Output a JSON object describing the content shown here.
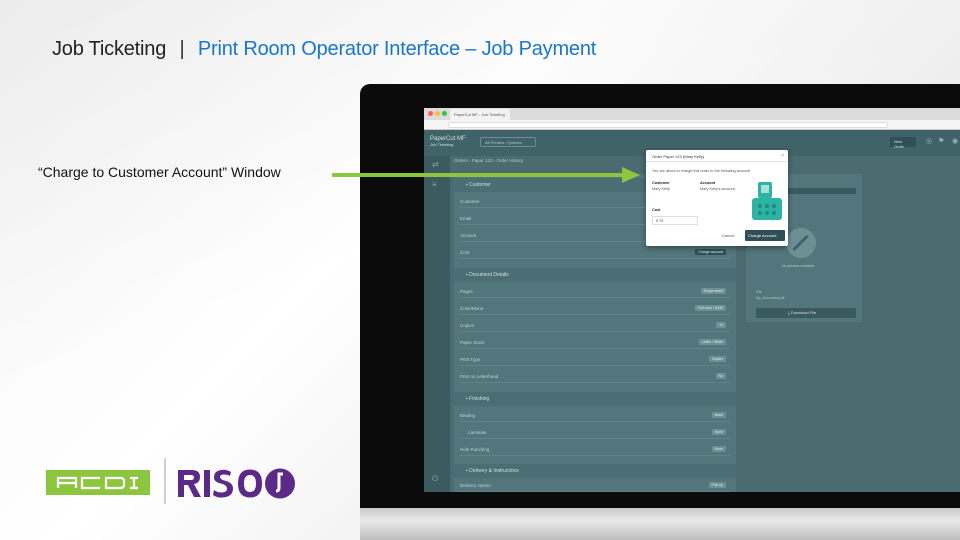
{
  "slide": {
    "title": "Job Ticketing",
    "separator": "|",
    "subtitle": "Print Room Operator Interface – Job Payment",
    "callout": "“Charge to Customer Account” Window"
  },
  "colors": {
    "accent_green": "#8cc63f",
    "title_blue": "#1a76c9",
    "app_teal": "#52767b",
    "modal_button": "#2f4f54"
  },
  "browser": {
    "tab_label": "PaperCut MF - Job Ticketing"
  },
  "app": {
    "logo_line1": "PaperCut MF",
    "logo_line2": "Job Ticketing",
    "header_dropdown": "All Printers / Queues",
    "new_job_button": "New Order",
    "breadcrumb": "Orders › Paper 123 › Order History",
    "sections": [
      {
        "title": "Customer",
        "icon": "person-icon"
      },
      {
        "title": "Document Details",
        "icon": "document-icon"
      },
      {
        "title": "Finishing",
        "icon": "finishing-icon"
      },
      {
        "title": "Delivery & Instructions",
        "icon": "truck-icon"
      }
    ],
    "customer_rows": [
      {
        "label": "Customer",
        "value": ""
      },
      {
        "label": "Email",
        "value": ""
      },
      {
        "label": "Account",
        "value": ""
      },
      {
        "label": "Cost",
        "value": "Charge account"
      }
    ],
    "document_rows": [
      {
        "label": "Pages",
        "value": "Single sided"
      },
      {
        "label": "Color/Mono",
        "value": "Full color / B&W"
      },
      {
        "label": "Copies",
        "value": "10"
      },
      {
        "label": "Paper Stock",
        "value": "Letter / White"
      },
      {
        "label": "Print Type",
        "value": "Duplex"
      },
      {
        "label": "Print on Letterhead",
        "value": "No"
      }
    ],
    "finishing_rows": [
      {
        "label": "Binding",
        "value": "None"
      },
      {
        "label": "Laminate",
        "value": "None"
      },
      {
        "label": "Hole Punching",
        "value": "None"
      }
    ],
    "delivery_rows": [
      {
        "label": "Delivery Option",
        "value": "Pick up"
      }
    ],
    "right_panel": {
      "preview_caption": "No preview available",
      "file_label": "File",
      "file_name": "My_Document.pdf",
      "download_button": "Download File"
    }
  },
  "modal": {
    "title": "Order Paper 123 (Mary Kelly)",
    "description": "You are about to charge this order to the following account",
    "customer_label": "Customer",
    "customer_value": "Mary Kelly",
    "account_label": "Account",
    "account_value": "Mary Kelly's account",
    "cost_label": "Cost",
    "cost_value": "5.70",
    "cancel_label": "Cancel",
    "charge_label": "Charge Account"
  },
  "logos": {
    "left_brand": "ACDI",
    "right_brand": "RISO"
  }
}
